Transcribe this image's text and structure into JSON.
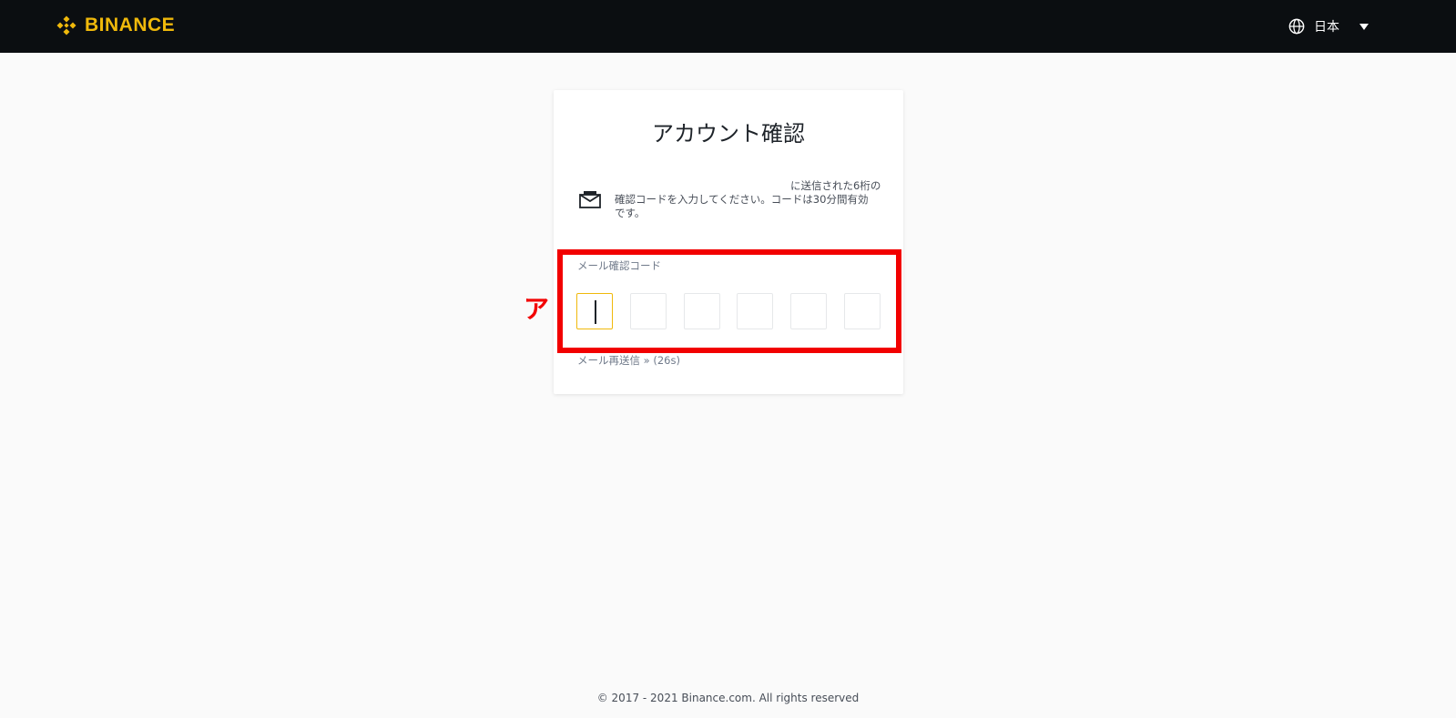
{
  "header": {
    "brand": "BINANCE",
    "language": "日本"
  },
  "card": {
    "title": "アカウント確認",
    "info_top": "に送信された6桁の",
    "info_main": "確認コードを入力してください。コードは30分間有効",
    "info_line3": "です。",
    "code_label": "メール確認コード",
    "code_digits": [
      "",
      "",
      "",
      "",
      "",
      ""
    ],
    "resend": "メール再送信 » (26s)"
  },
  "annotation": {
    "marker": "ア",
    "color": "#f20000"
  },
  "footer": {
    "copyright": "© 2017 - 2021 Binance.com. All rights reserved"
  },
  "colors": {
    "brand": "#f0b90b",
    "topbar": "#0b0e11"
  }
}
